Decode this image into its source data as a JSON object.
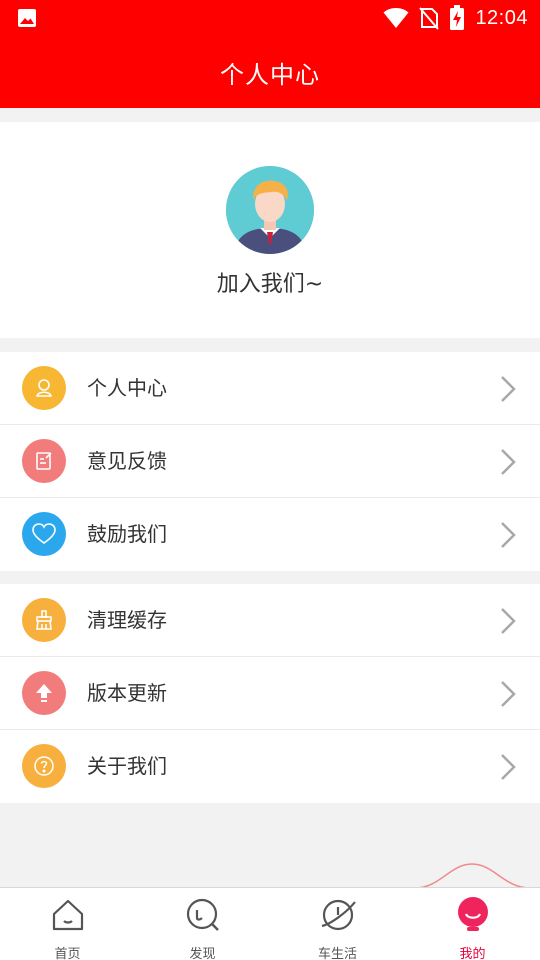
{
  "status_bar": {
    "time": "12:04"
  },
  "header": {
    "title": "个人中心"
  },
  "profile": {
    "join_label": "加入我们~"
  },
  "menu_groups": [
    [
      {
        "label": "个人中心",
        "icon": "user-icon",
        "color": "#f7b733"
      },
      {
        "label": "意见反馈",
        "icon": "feedback-icon",
        "color": "#f27c7c"
      },
      {
        "label": "鼓励我们",
        "icon": "heart-icon",
        "color": "#2ba7ee"
      }
    ],
    [
      {
        "label": "清理缓存",
        "icon": "broom-icon",
        "color": "#f7b03d"
      },
      {
        "label": "版本更新",
        "icon": "upload-icon",
        "color": "#f27c7c"
      },
      {
        "label": "关于我们",
        "icon": "question-icon",
        "color": "#f7b03d"
      }
    ]
  ],
  "tabbar": {
    "tabs": [
      {
        "label": "首页",
        "icon": "home-icon"
      },
      {
        "label": "发现",
        "icon": "discover-icon"
      },
      {
        "label": "车生活",
        "icon": "planet-icon"
      },
      {
        "label": "我的",
        "icon": "mine-icon",
        "active": true
      }
    ],
    "active_color": "#e8003c"
  }
}
